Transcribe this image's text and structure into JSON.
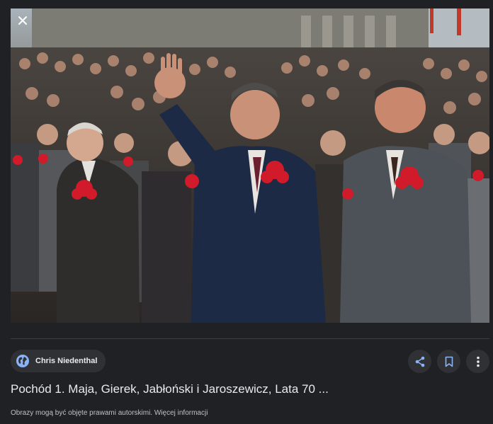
{
  "viewer": {
    "source_name": "Chris Niedenthal",
    "title": "Pochód 1. Maja, Gierek, Jabłoński i Jaroszewicz, Lata 70 ...",
    "copyright_text": "Obrazy mogą być objęte prawami autorskimi.",
    "copyright_link": "Więcej informacji"
  },
  "icons": {
    "close": "close-icon",
    "globe": "globe-icon",
    "share": "share-icon",
    "save": "bookmark-icon",
    "more": "more-vert-icon"
  },
  "colors": {
    "background": "#202124",
    "chip": "#303134",
    "text": "#e8eaed",
    "subtext": "#bdc1c6"
  }
}
